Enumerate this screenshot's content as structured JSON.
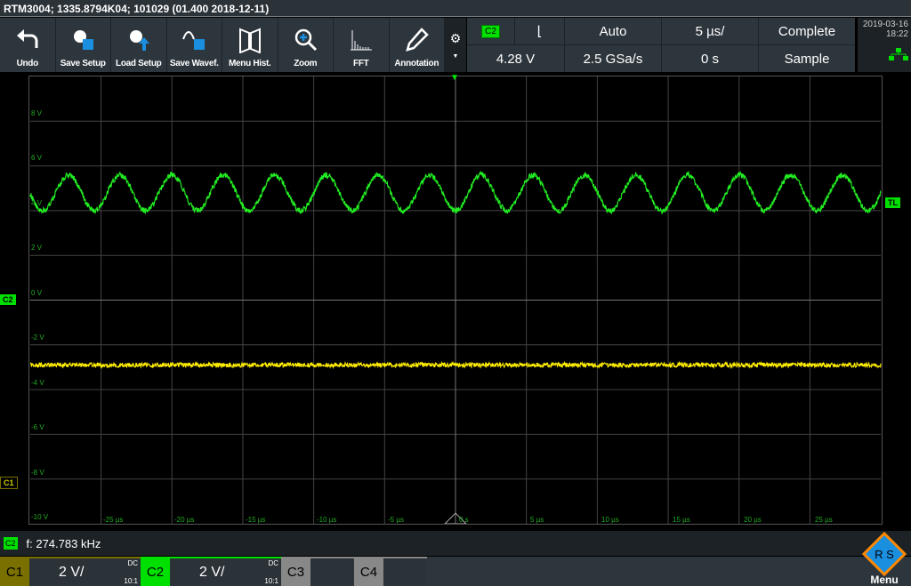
{
  "title": "RTM3004; 1335.8794K04; 101029 (01.400 2018-12-11)",
  "toolbar": [
    {
      "label": "Undo",
      "icon": "undo-icon"
    },
    {
      "label": "Save Setup",
      "icon": "save-setup-icon"
    },
    {
      "label": "Load Setup",
      "icon": "load-setup-icon"
    },
    {
      "label": "Save Wavef.",
      "icon": "save-waveform-icon"
    },
    {
      "label": "Menu Hist.",
      "icon": "menu-history-icon"
    },
    {
      "label": "Zoom",
      "icon": "zoom-icon"
    },
    {
      "label": "FFT",
      "icon": "fft-icon"
    },
    {
      "label": "Annotation",
      "icon": "pencil-icon"
    }
  ],
  "status": {
    "trigger_source": "C2",
    "trigger_slope": "falling",
    "trigger_mode": "Auto",
    "timebase": "5 µs/",
    "acq_state": "Complete",
    "trigger_level": "4.28 V",
    "sample_rate": "2.5 GSa/s",
    "position": "0 s",
    "acq_mode": "Sample"
  },
  "date": "2019-03-16",
  "time": "18:22",
  "y_labels": [
    "8 V",
    "6 V",
    "4 V",
    "2 V",
    "0 V",
    "-2 V",
    "-4 V",
    "-6 V",
    "-8 V",
    "-10 V"
  ],
  "x_labels": [
    "-25 µs",
    "-20 µs",
    "-15 µs",
    "-10 µs",
    "-5 µs",
    "0 s",
    "5 µs",
    "10 µs",
    "15 µs",
    "20 µs",
    "25 µs"
  ],
  "markers": {
    "c2": "C2",
    "c1": "C1",
    "trigger": "TL"
  },
  "measurement": {
    "channel": "C2",
    "text": "f: 274.783 kHz"
  },
  "channels": [
    {
      "name": "C1",
      "scale": "2 V/",
      "coupling": "DC",
      "probe": "10:1",
      "color": "#7a7000"
    },
    {
      "name": "C2",
      "scale": "2 V/",
      "coupling": "DC",
      "probe": "10:1",
      "color": "#00e000"
    },
    {
      "name": "C3",
      "color": "#888"
    },
    {
      "name": "C4",
      "color": "#888"
    }
  ],
  "menu_label": "Menu",
  "logo_text": "RS",
  "waveforms": {
    "c2": {
      "offset_v": 4.8,
      "amplitude_v": 0.8,
      "frequency_khz": 274.783,
      "color": "#22ee22"
    },
    "c1": {
      "level_v": -2.9,
      "color": "#ffee00"
    }
  }
}
